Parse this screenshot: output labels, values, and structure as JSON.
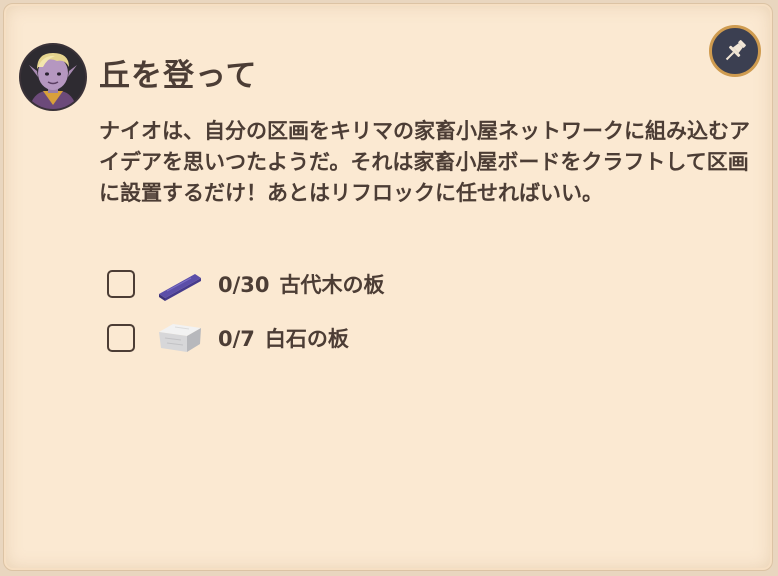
{
  "quest": {
    "title": "丘を登って",
    "description": "ナイオは、自分の区画をキリマの家畜小屋ネットワークに組み込むアイデアを思いつたようだ。それは家畜小屋ボードをクラフトして区画に設置するだけ！あとはリフロックに任せればいい。",
    "objectives": [
      {
        "progress": "0/30",
        "item": "古代木の板",
        "icon": "wood-plank-icon",
        "done": false
      },
      {
        "progress": "0/7",
        "item": "白石の板",
        "icon": "white-stone-slab-icon",
        "done": false
      }
    ]
  },
  "icons": {
    "pin": "pushpin-icon",
    "avatar": "character-portrait"
  },
  "colors": {
    "panel_bg": "#fbe9d2",
    "text": "#4c3d35",
    "pin_bg": "#3b3f51",
    "pin_border": "#cf9b4f"
  }
}
